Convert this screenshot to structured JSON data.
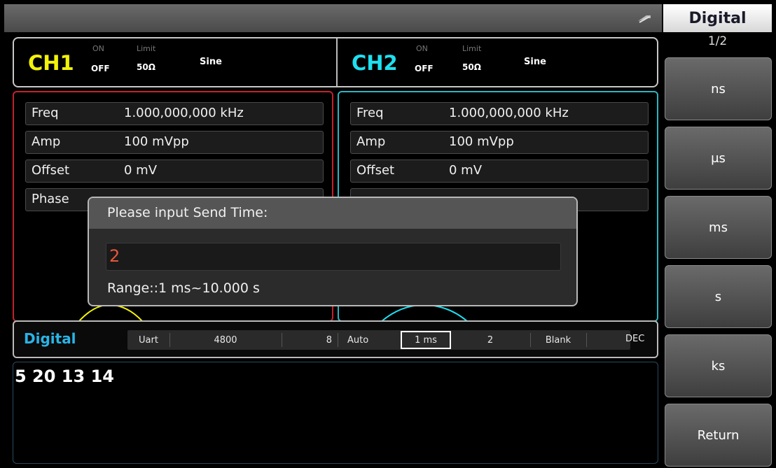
{
  "menu": {
    "title": "Digital",
    "page": "1/2",
    "softkeys": [
      "ns",
      "μs",
      "ms",
      "s",
      "ks",
      "Return"
    ]
  },
  "topbar": {
    "icon": "usb-icon"
  },
  "ch1": {
    "name": "CH1",
    "on": "ON",
    "state": "OFF",
    "limit": "Limit",
    "impedance": "50Ω",
    "waveform": "Sine",
    "color": "#f2f20a",
    "params": [
      {
        "label": "Freq",
        "value": "1.000,000,000 kHz"
      },
      {
        "label": "Amp",
        "value": "100 mVpp"
      },
      {
        "label": "Offset",
        "value": "0 mV"
      },
      {
        "label": "Phase",
        "value": ""
      }
    ]
  },
  "ch2": {
    "name": "CH2",
    "on": "ON",
    "state": "OFF",
    "limit": "Limit",
    "impedance": "50Ω",
    "waveform": "Sine",
    "color": "#1ee0f0",
    "params": [
      {
        "label": "Freq",
        "value": "1.000,000,000 kHz"
      },
      {
        "label": "Amp",
        "value": "100 mVpp"
      },
      {
        "label": "Offset",
        "value": "0 mV"
      },
      {
        "label": "",
        "value": ""
      }
    ]
  },
  "digital": {
    "title": "Digital",
    "protocol": "Uart",
    "baud": "4800",
    "bits": "8",
    "mode": "Auto",
    "send_time": "1 ms",
    "count": "2",
    "blank": "Blank",
    "format": "DEC"
  },
  "data": {
    "text": "5 20 13 14"
  },
  "dialog": {
    "title": "Please input Send Time:",
    "value": "2",
    "range": "Range::1 ms~10.000 s"
  },
  "colors": {
    "ch1_border": "#c2222a",
    "ch2_border": "#2ab4c0",
    "digital_title": "#2ab4e6",
    "input_text": "#e8573a"
  }
}
